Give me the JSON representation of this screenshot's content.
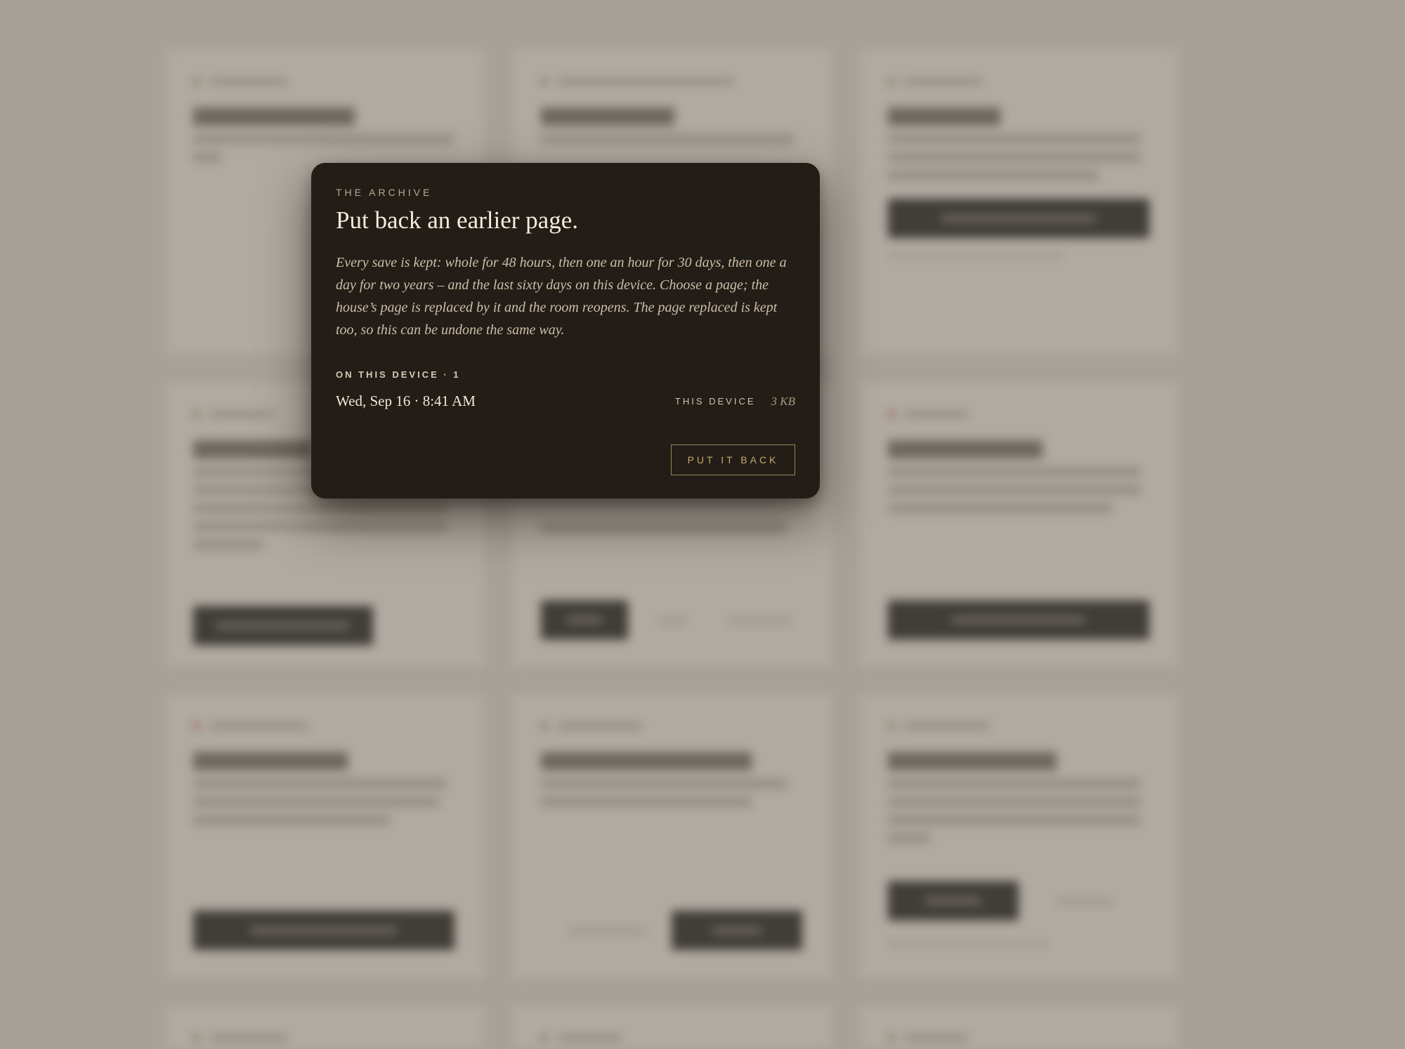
{
  "modal": {
    "eyebrow": "THE ARCHIVE",
    "title": "Put back an earlier page.",
    "body": "Every save is kept: whole for 48 hours, then one an hour for 30 days, then one a day for two years – and the last sixty days on this device. Choose a page; the house’s page is replaced by it and the room reopens. The page replaced is kept too, so this can be undone the same way.",
    "section_label": "ON THIS DEVICE · 1",
    "entries": [
      {
        "date": "Wed, Sep 16 · 8:41 AM",
        "where": "THIS DEVICE",
        "size": "3 KB"
      }
    ],
    "action_label": "PUT IT BACK"
  },
  "colors": {
    "modal_bg": "#221d17",
    "accent": "#c9a86a",
    "page_bg": "#a7a199"
  }
}
